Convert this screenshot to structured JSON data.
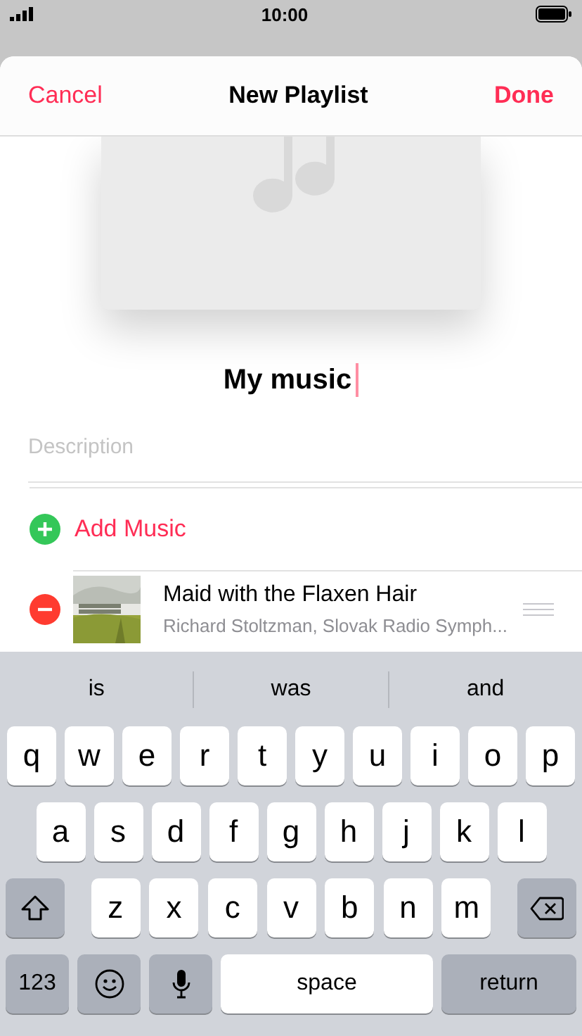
{
  "status_bar": {
    "time": "10:00"
  },
  "sheet": {
    "cancel": "Cancel",
    "title": "New Playlist",
    "done": "Done"
  },
  "playlist": {
    "artwork": {
      "kind": "placeholder"
    },
    "name": "My music",
    "description_placeholder": "Description"
  },
  "add_music": "Add Music",
  "songs": [
    {
      "title": "Maid with the Flaxen Hair",
      "artist": "Richard Stoltzman, Slovak Radio Symph..."
    }
  ],
  "suggestions": [
    "is",
    "was",
    "and"
  ],
  "keyboard": [
    [
      {
        "kind": "letter",
        "label": "q"
      },
      {
        "kind": "letter",
        "label": "w"
      },
      {
        "kind": "letter",
        "label": "e"
      },
      {
        "kind": "letter",
        "label": "r"
      },
      {
        "kind": "letter",
        "label": "t"
      },
      {
        "kind": "letter",
        "label": "y"
      },
      {
        "kind": "letter",
        "label": "u"
      },
      {
        "kind": "letter",
        "label": "i"
      },
      {
        "kind": "letter",
        "label": "o"
      },
      {
        "kind": "letter",
        "label": "p"
      }
    ],
    [
      {
        "kind": "letter",
        "label": "a"
      },
      {
        "kind": "letter",
        "label": "s"
      },
      {
        "kind": "letter",
        "label": "d"
      },
      {
        "kind": "letter",
        "label": "f"
      },
      {
        "kind": "letter",
        "label": "g"
      },
      {
        "kind": "letter",
        "label": "h"
      },
      {
        "kind": "letter",
        "label": "j"
      },
      {
        "kind": "letter",
        "label": "k"
      },
      {
        "kind": "letter",
        "label": "l"
      }
    ],
    [
      {
        "kind": "shift"
      },
      {
        "kind": "letter",
        "label": "z"
      },
      {
        "kind": "letter",
        "label": "x"
      },
      {
        "kind": "letter",
        "label": "c"
      },
      {
        "kind": "letter",
        "label": "v"
      },
      {
        "kind": "letter",
        "label": "b"
      },
      {
        "kind": "letter",
        "label": "n"
      },
      {
        "kind": "letter",
        "label": "m"
      },
      {
        "kind": "delete"
      }
    ],
    [
      {
        "kind": "mode",
        "label": "123"
      },
      {
        "kind": "emoji"
      },
      {
        "kind": "mic"
      },
      {
        "kind": "space",
        "label": "space"
      },
      {
        "kind": "return",
        "label": "return"
      }
    ]
  ]
}
